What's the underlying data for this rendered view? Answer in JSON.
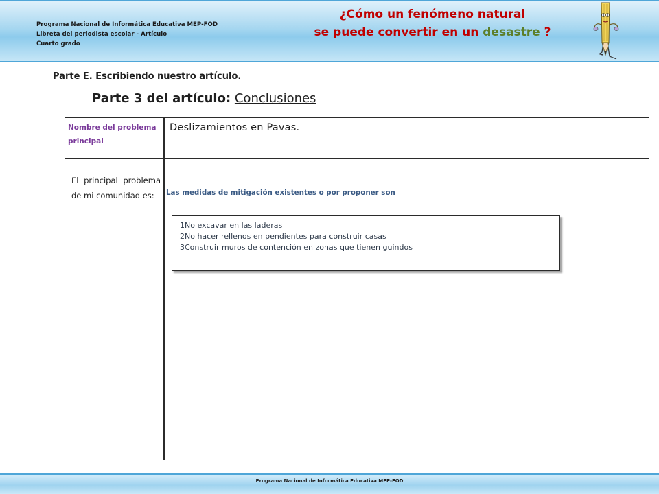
{
  "header": {
    "program_line": "Programa Nacional de Informática Educativa MEP-FOD",
    "notebook_line": "Libreta del periodista escolar -  Artículo",
    "grade_line": "Cuarto grado",
    "title_line1": "¿Cómo un fenómeno natural",
    "title_line2_prefix": "se puede convertir en un ",
    "title_line2_highlight": "desastre",
    "title_line2_suffix": " ?",
    "title_color": "#c00000",
    "highlight_color": "#5c7f2a",
    "mascot_icon": "pencil-character-icon"
  },
  "section": {
    "part_e": "Parte E. Escribiendo nuestro artículo.",
    "part3_label": "Parte 3 del artículo:",
    "part3_topic": "Conclusiones"
  },
  "table": {
    "name_label": "Nombre del problema principal",
    "name_value": "Deslizamientos en Pavas.",
    "problem_label": "El principal problema de mi comunidad es:",
    "mitigation_label": "Las medidas de mitigación  existentes o por proponer son",
    "label_color": "#7a3a9a",
    "mitigation_color": "#3a5a84",
    "measures": [
      "1No excavar en las laderas",
      "2No hacer rellenos en pendientes para construir casas",
      "3Construir muros de contención en zonas que tienen guindos"
    ]
  },
  "footer": {
    "text": "Programa  Nacional de Informática  Educativa MEP-FOD"
  }
}
